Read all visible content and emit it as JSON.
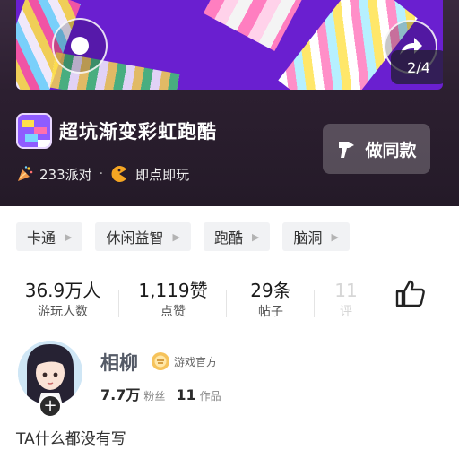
{
  "preview": {
    "page_indicator": "2/4"
  },
  "game": {
    "title": "超坑渐变彩虹跑酷",
    "party_count": "233派对",
    "separator": "·",
    "instant_play": "即点即玩",
    "same_style_button": "做同款"
  },
  "tags": [
    {
      "label": "卡通"
    },
    {
      "label": "休闲益智"
    },
    {
      "label": "跑酷"
    },
    {
      "label": "脑洞"
    }
  ],
  "stats": [
    {
      "value": "36.9万人",
      "label": "游玩人数"
    },
    {
      "value": "1,119赞",
      "label": "点赞"
    },
    {
      "value": "29条",
      "label": "帖子"
    },
    {
      "value": "11",
      "label": "评"
    }
  ],
  "author": {
    "name": "相柳",
    "badge": "游戏官方",
    "followers_value": "7.7万",
    "followers_label": "粉丝",
    "works_value": "11",
    "works_label": "作品",
    "follow_symbol": "+"
  },
  "bio": "TA什么都没有写",
  "icons": {
    "play": "play-icon",
    "share": "share-icon",
    "party": "party-popper-icon",
    "instant": "pacman-icon",
    "same_style": "hammer-icon",
    "like": "thumbs-up-icon",
    "official": "official-badge-icon"
  },
  "colors": {
    "preview_purple": "#6a1fd0",
    "header_bg": "#2c1f30",
    "tag_bg": "#f1f2f4",
    "author_name": "#555b67"
  }
}
